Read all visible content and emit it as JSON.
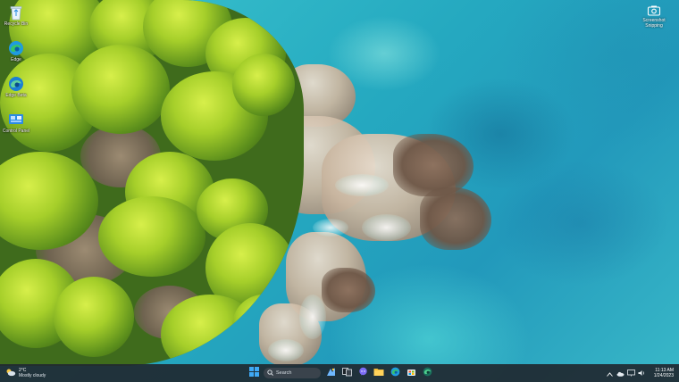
{
  "desktop": {
    "icons": [
      {
        "name": "recycle-bin",
        "label": "Recycle Bin",
        "icon": "recycle-bin-icon"
      },
      {
        "name": "edge",
        "label": "Edge",
        "icon": "edge-icon"
      },
      {
        "name": "edge-beta",
        "label": "Edge Beta",
        "icon": "edge-beta-icon"
      },
      {
        "name": "control-panel",
        "label": "Control Panel",
        "icon": "control-panel-icon"
      }
    ],
    "snip_widget": {
      "label": "Screenshot Snipping",
      "icon": "camera-icon"
    }
  },
  "taskbar": {
    "weather": {
      "temp": "2°C",
      "condition": "Mostly cloudy",
      "icon": "cloud-sun-icon"
    },
    "search": {
      "placeholder": "Search"
    },
    "apps": [
      {
        "name": "start",
        "icon": "windows-start-icon"
      },
      {
        "name": "widgets",
        "icon": "widgets-icon"
      },
      {
        "name": "task-view",
        "icon": "task-view-icon"
      },
      {
        "name": "chat",
        "icon": "chat-icon"
      },
      {
        "name": "file-explorer",
        "icon": "folder-icon"
      },
      {
        "name": "edge",
        "icon": "edge-icon"
      },
      {
        "name": "store",
        "icon": "store-icon"
      },
      {
        "name": "edge-dev",
        "icon": "edge-dev-icon"
      }
    ],
    "clock": {
      "time": "11:13 AM",
      "date": "1/24/2023"
    }
  },
  "colors": {
    "taskbar_bg": "#20282f",
    "accent": "#0a84d8",
    "water": "#2fb7c4",
    "forest": "#a6cf2a"
  }
}
